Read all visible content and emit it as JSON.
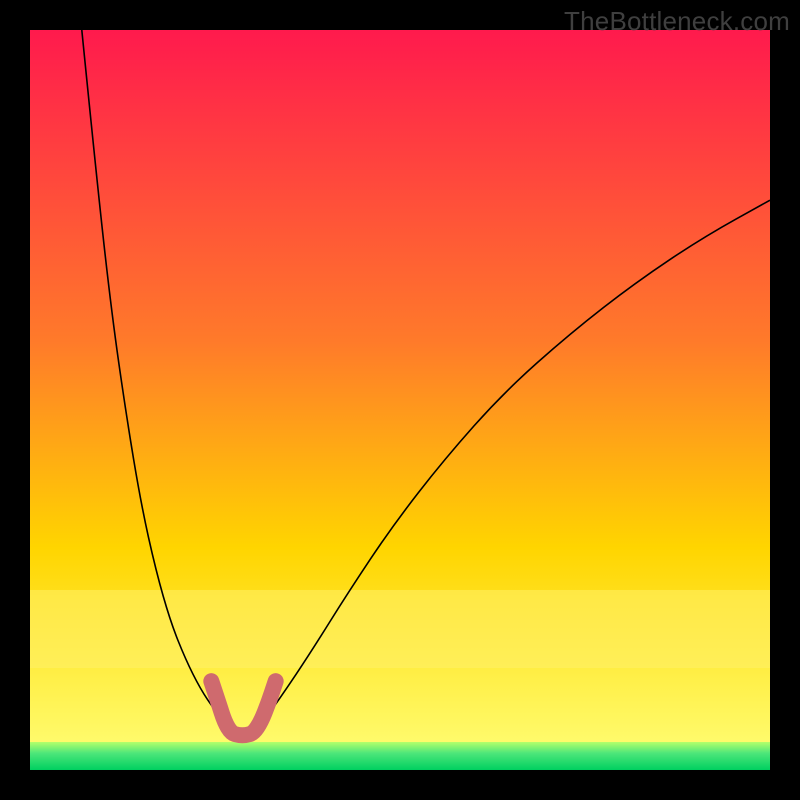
{
  "watermark": "TheBottleneck.com",
  "chart_data": {
    "type": "line",
    "title": "",
    "xlabel": "",
    "ylabel": "",
    "xlim": [
      0,
      100
    ],
    "ylim": [
      0,
      100
    ],
    "grid": false,
    "legend": false,
    "background": {
      "gradient_top": "#ff1a4d",
      "gradient_mid": "#ffd500",
      "gradient_bottom": "#00e060",
      "yellow_band_y": [
        78,
        88
      ],
      "green_band_y": [
        96,
        100
      ]
    },
    "series": [
      {
        "name": "curve-left",
        "color": "#000000",
        "width": 1.5,
        "x": [
          7,
          9,
          11,
          13,
          15,
          17,
          19,
          21,
          23,
          25,
          26.5
        ],
        "y": [
          0,
          20,
          38,
          52,
          64,
          73,
          80,
          85,
          89,
          92,
          93.5
        ]
      },
      {
        "name": "curve-right",
        "color": "#000000",
        "width": 1.5,
        "x": [
          31.5,
          34,
          38,
          43,
          49,
          56,
          64,
          73,
          82,
          91,
          100
        ],
        "y": [
          93.5,
          90,
          84,
          76,
          67,
          58,
          49,
          41,
          34,
          28,
          23
        ]
      },
      {
        "name": "bottom-u",
        "color": "#cf6a6e",
        "width": 10,
        "x": [
          24.5,
          25.5,
          26.3,
          27.2,
          28.2,
          29.2,
          30.2,
          31.2,
          32.2,
          33.2
        ],
        "y": [
          88.0,
          91.0,
          93.5,
          95.0,
          95.3,
          95.3,
          95.0,
          93.5,
          91.0,
          88.0
        ]
      }
    ]
  }
}
